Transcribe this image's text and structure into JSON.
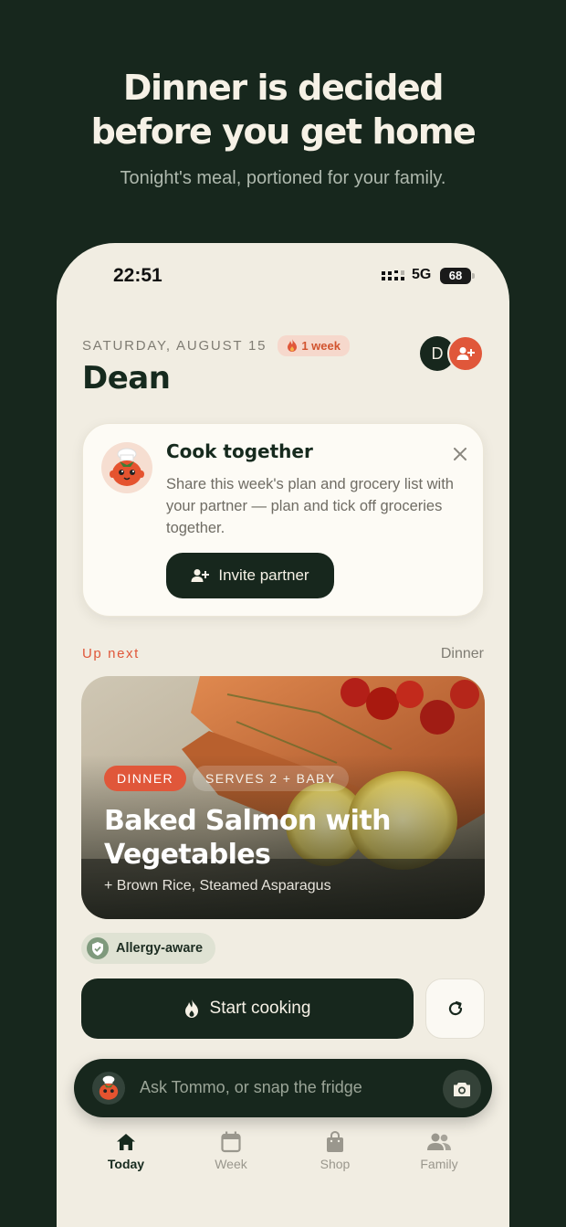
{
  "promo": {
    "headline_line1": "Dinner is decided",
    "headline_line2": "before you get home",
    "subhead": "Tonight's meal, portioned for your family."
  },
  "status_bar": {
    "time": "22:51",
    "network": "5G",
    "battery": "68"
  },
  "header": {
    "date": "SATURDAY, AUGUST 15",
    "streak": "1 week",
    "greeting_name": "Dean",
    "avatar_initial": "D"
  },
  "invite_card": {
    "title": "Cook together",
    "body": "Share this week's plan and grocery list with your partner — plan and tick off groceries together.",
    "button_label": "Invite partner"
  },
  "up_next": {
    "label": "Up next",
    "meal_type": "Dinner",
    "pill_type": "DINNER",
    "pill_serves": "SERVES 2 + BABY",
    "title": "Baked Salmon with Vegetables",
    "sides": "+ Brown Rice, Steamed Asparagus",
    "allergy_badge": "Allergy-aware"
  },
  "actions": {
    "start_label": "Start cooking"
  },
  "assistant": {
    "placeholder": "Ask Tommo, or snap the fridge"
  },
  "tabs": [
    {
      "label": "Today",
      "icon": "home-icon",
      "active": true
    },
    {
      "label": "Week",
      "icon": "calendar-icon",
      "active": false
    },
    {
      "label": "Shop",
      "icon": "bag-icon",
      "active": false
    },
    {
      "label": "Family",
      "icon": "people-icon",
      "active": false
    }
  ],
  "colors": {
    "background_dark": "#17271d",
    "surface": "#f1ede2",
    "accent": "#e0573a"
  }
}
